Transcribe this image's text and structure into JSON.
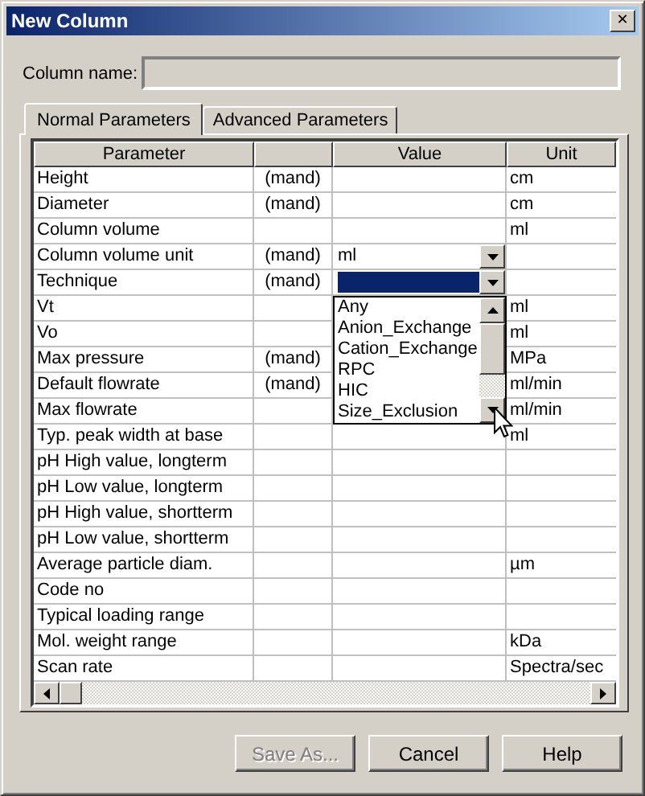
{
  "window": {
    "title": "New Column",
    "close_glyph": "✕"
  },
  "column_name": {
    "label": "Column name:"
  },
  "tabs": [
    {
      "label": "Normal Parameters",
      "selected": true
    },
    {
      "label": "Advanced Parameters",
      "selected": false
    }
  ],
  "table": {
    "columns": [
      "Parameter",
      "",
      "Value",
      "Unit"
    ],
    "rows": [
      {
        "parameter": "Height",
        "mandatory": "(mand)",
        "unit": "cm",
        "kind": "text"
      },
      {
        "parameter": "Diameter",
        "mandatory": "(mand)",
        "unit": "cm",
        "kind": "text"
      },
      {
        "parameter": "Column volume",
        "unit": "ml",
        "kind": "text"
      },
      {
        "parameter": "Column volume unit",
        "mandatory": "(mand)",
        "value": "ml",
        "kind": "dropdown",
        "open": false
      },
      {
        "parameter": "Technique",
        "mandatory": "(mand)",
        "kind": "dropdown",
        "open": true,
        "options": [
          "Any",
          "Anion_Exchange",
          "Cation_Exchange",
          "RPC",
          "HIC",
          "Size_Exclusion"
        ]
      },
      {
        "parameter": "Vt",
        "unit": "ml",
        "kind": "text"
      },
      {
        "parameter": "Vo",
        "unit": "ml",
        "kind": "text"
      },
      {
        "parameter": "Max pressure",
        "mandatory": "(mand)",
        "unit": "MPa",
        "kind": "text"
      },
      {
        "parameter": "Default flowrate",
        "mandatory": "(mand)",
        "unit": "ml/min",
        "kind": "text"
      },
      {
        "parameter": "Max flowrate",
        "unit": "ml/min",
        "kind": "text"
      },
      {
        "parameter": "Typ. peak width at base",
        "unit": "ml",
        "kind": "text"
      },
      {
        "parameter": "pH High value, longterm",
        "kind": "text"
      },
      {
        "parameter": "pH Low value, longterm",
        "kind": "text"
      },
      {
        "parameter": "pH High value, shortterm",
        "kind": "text"
      },
      {
        "parameter": "pH Low value, shortterm",
        "kind": "text"
      },
      {
        "parameter": "Average particle diam.",
        "unit": "µm",
        "kind": "text"
      },
      {
        "parameter": "Code no",
        "kind": "text"
      },
      {
        "parameter": "Typical loading range",
        "kind": "text"
      },
      {
        "parameter": "Mol. weight range",
        "unit": "kDa",
        "kind": "text"
      },
      {
        "parameter": "Scan rate",
        "unit": "Spectra/sec",
        "kind": "text"
      }
    ]
  },
  "buttons": [
    {
      "label": "Save As...",
      "disabled": true
    },
    {
      "label": "Cancel",
      "disabled": false
    },
    {
      "label": "Help",
      "disabled": false
    }
  ]
}
